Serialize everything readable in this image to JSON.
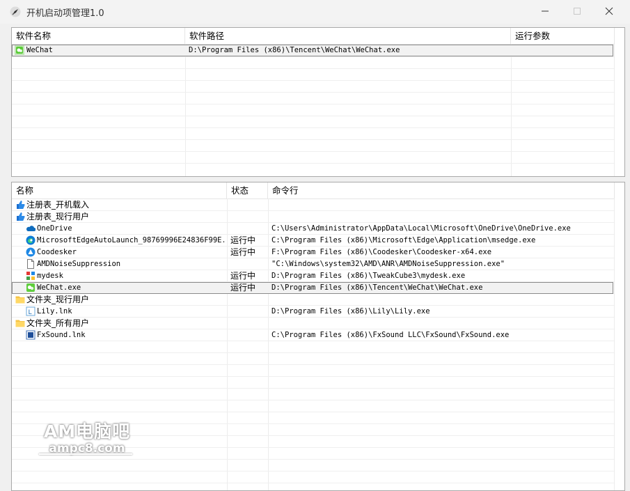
{
  "window": {
    "title": "开机启动项管理1.0"
  },
  "top_table": {
    "headers": [
      "软件名称",
      "软件路径",
      "运行参数"
    ],
    "rows": [
      {
        "name": "WeChat",
        "path": "D:\\Program Files (x86)\\Tencent\\WeChat\\WeChat.exe",
        "params": ""
      }
    ]
  },
  "bottom_table": {
    "headers": [
      "名称",
      "状态",
      "命令行"
    ],
    "rows": [
      {
        "name": "注册表_开机载入",
        "status": "",
        "cmd": "",
        "icon": "thumb-icon",
        "indent": 0
      },
      {
        "name": "注册表_现行用户",
        "status": "",
        "cmd": "",
        "icon": "thumb-icon",
        "indent": 0
      },
      {
        "name": "OneDrive",
        "status": "",
        "cmd": "C:\\Users\\Administrator\\AppData\\Local\\Microsoft\\OneDrive\\OneDrive.exe",
        "icon": "onedrive-icon",
        "indent": 1
      },
      {
        "name": "MicrosoftEdgeAutoLaunch_98769996E24836F99E...",
        "status": "运行中",
        "cmd": "C:\\Program Files (x86)\\Microsoft\\Edge\\Application\\msedge.exe",
        "icon": "edge-icon",
        "indent": 1
      },
      {
        "name": "Coodesker",
        "status": "运行中",
        "cmd": "F:\\Program Files (x86)\\Coodesker\\Coodesker-x64.exe",
        "icon": "coodesker-icon",
        "indent": 1
      },
      {
        "name": "AMDNoiseSuppression",
        "status": "",
        "cmd": "\"C:\\Windows\\system32\\AMD\\ANR\\AMDNoiseSuppression.exe\"",
        "icon": "file-icon",
        "indent": 1
      },
      {
        "name": "mydesk",
        "status": "运行中",
        "cmd": "D:\\Program Files (x86)\\TweakCube3\\mydesk.exe",
        "icon": "mydesk-icon",
        "indent": 1
      },
      {
        "name": "WeChat.exe",
        "status": "运行中",
        "cmd": "D:\\Program Files (x86)\\Tencent\\WeChat\\WeChat.exe",
        "icon": "wechat-icon",
        "indent": 1,
        "selected": true
      },
      {
        "name": "文件夹_现行用户",
        "status": "",
        "cmd": "",
        "icon": "folder-icon",
        "indent": 0
      },
      {
        "name": "Lily.lnk",
        "status": "",
        "cmd": "D:\\Program Files (x86)\\Lily\\Lily.exe",
        "icon": "lily-icon",
        "indent": 1
      },
      {
        "name": "文件夹_所有用户",
        "status": "",
        "cmd": "",
        "icon": "folder-icon",
        "indent": 0
      },
      {
        "name": "FxSound.lnk",
        "status": "",
        "cmd": "C:\\Program Files (x86)\\FxSound LLC\\FxSound\\FxSound.exe",
        "icon": "fxsound-icon",
        "indent": 1
      }
    ]
  },
  "watermark": {
    "line1": "AM电脑吧",
    "line2": "ampc8.com"
  },
  "colors": {
    "accent": "#0078d4",
    "folder": "#f6c445",
    "wechat": "#2dc100"
  }
}
